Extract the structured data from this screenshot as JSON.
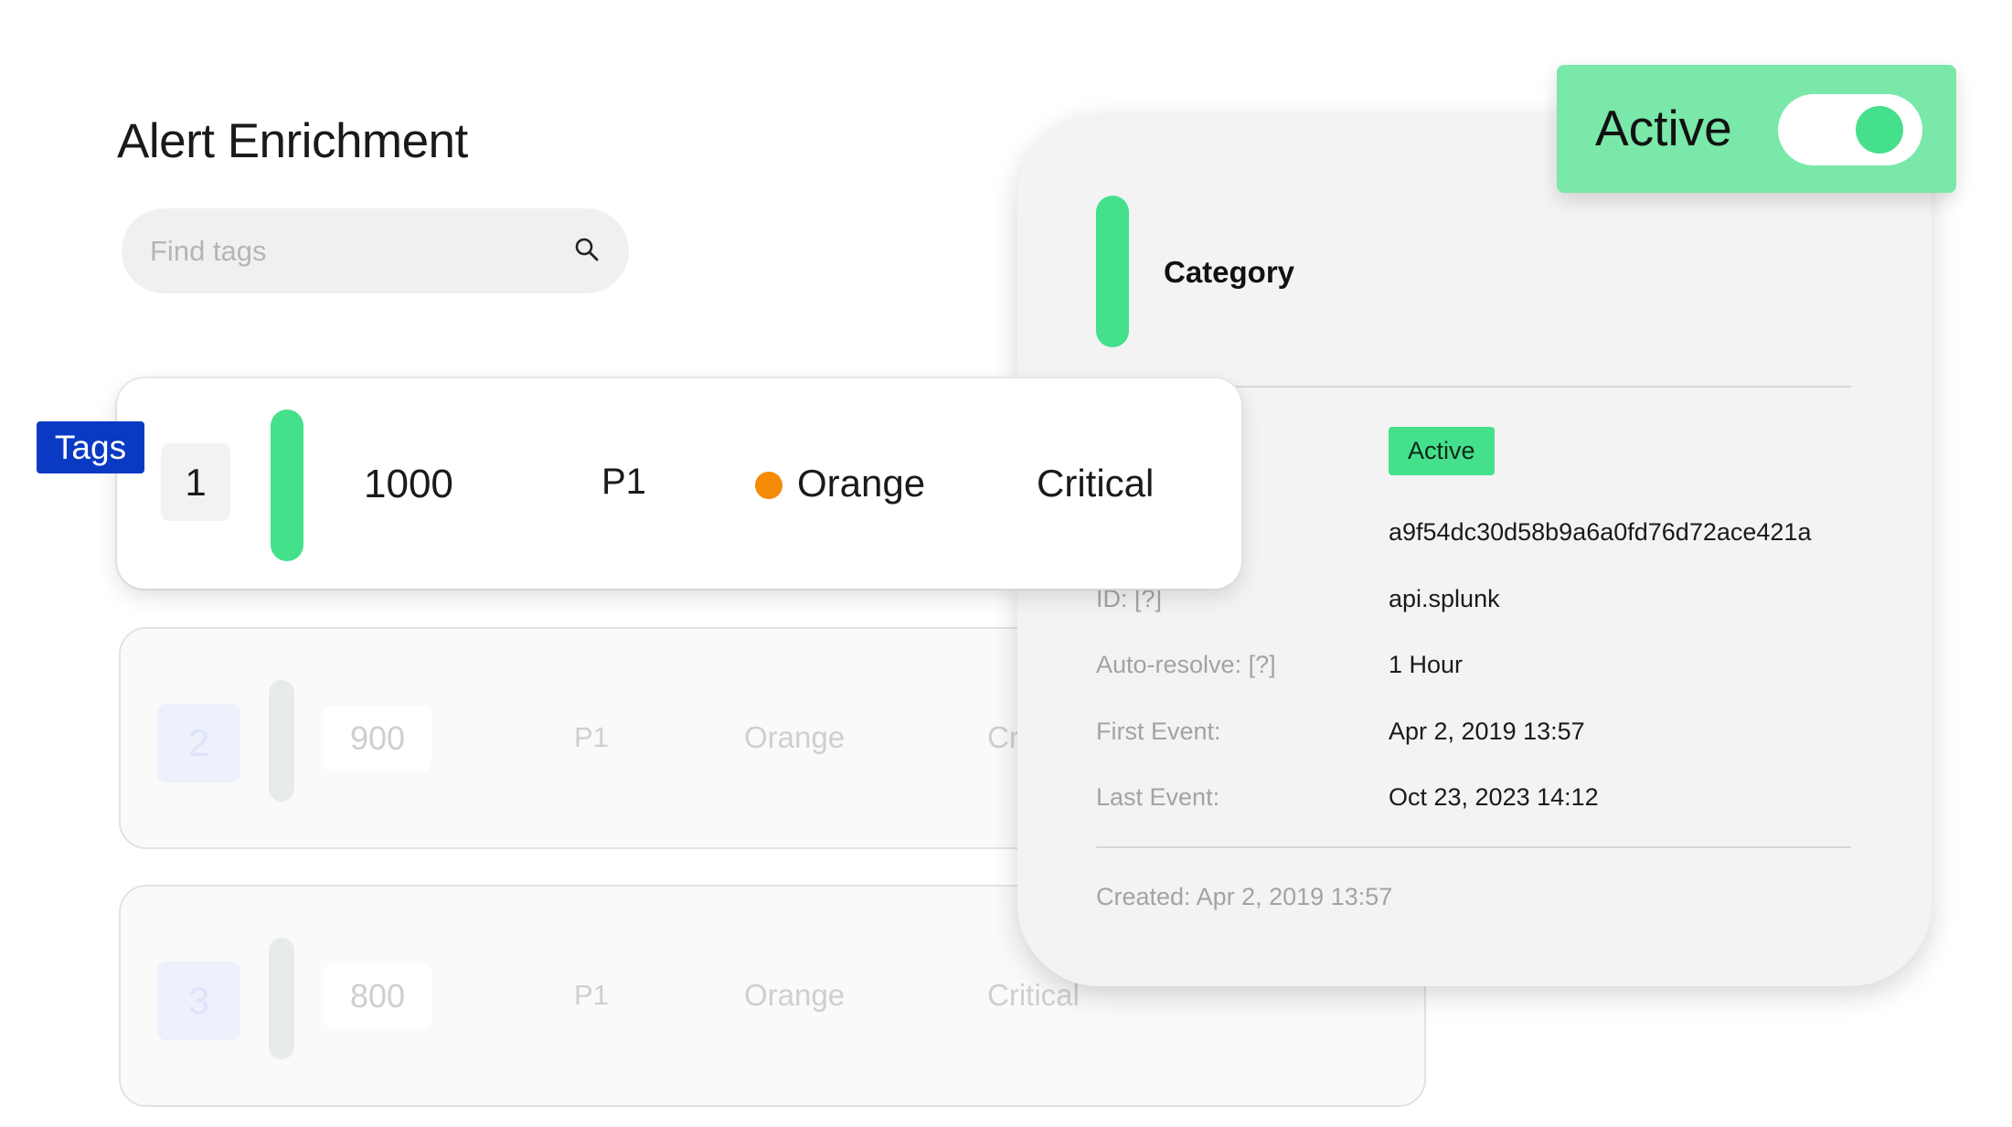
{
  "header": {
    "title": "Alert Enrichment"
  },
  "search": {
    "placeholder": "Find tags"
  },
  "tags_badge": {
    "label": "Tags"
  },
  "rows": [
    {
      "index": "1",
      "value": "1000",
      "priority": "P1",
      "color_name": "Orange",
      "color_hex": "#f58a07",
      "severity": "Critical"
    },
    {
      "index": "2",
      "value": "900",
      "priority": "P1",
      "color_name": "Orange",
      "severity": "Cri"
    },
    {
      "index": "3",
      "value": "800",
      "priority": "P1",
      "color_name": "Orange",
      "severity": "Critical"
    }
  ],
  "detail": {
    "section_title": "Category",
    "status_badge": "Active",
    "hash": "a9f54dc30d58b9a6a0fd76d72ace421a",
    "fields": [
      {
        "label": "ID: [?]",
        "value": "api.splunk"
      },
      {
        "label": "Auto-resolve: [?]",
        "value": "1 Hour"
      },
      {
        "label": "First Event:",
        "value": "Apr 2, 2019 13:57"
      },
      {
        "label": "Last Event:",
        "value": "Oct 23, 2023 14:12"
      }
    ],
    "created": "Created: Apr 2, 2019 13:57"
  },
  "toggle": {
    "label": "Active",
    "on": true
  },
  "colors": {
    "accent_green": "#45e08c",
    "toggle_card": "#79e8a8",
    "tags_blue": "#0a3ac4",
    "orange": "#f58a07"
  }
}
